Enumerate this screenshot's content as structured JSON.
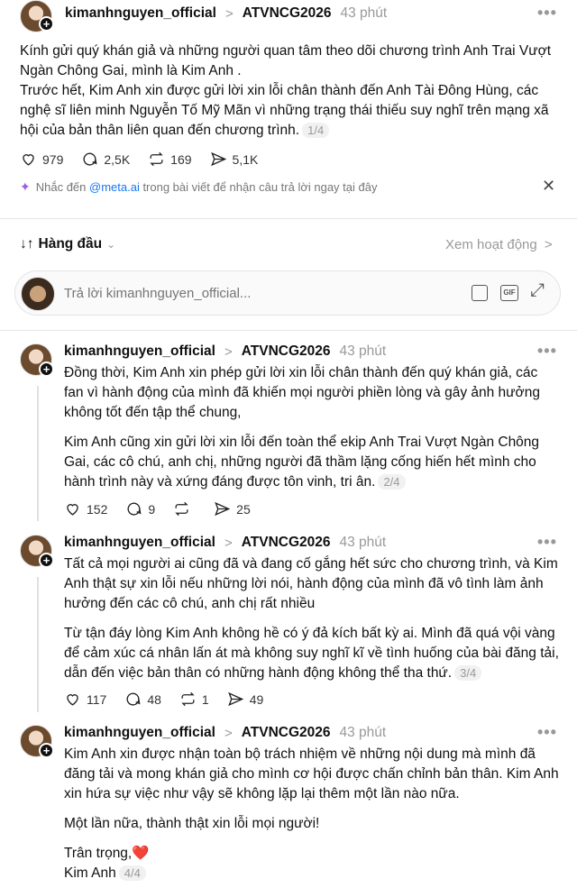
{
  "post": {
    "username": "kimanhnguyen_official",
    "tag": "ATVNCG2026",
    "time": "43 phút",
    "paragraphs": [
      "Kính gửi quý khán giả và những người quan tâm theo dõi chương trình Anh Trai Vượt Ngàn Chông Gai, mình là Kim Anh .",
      "Trước hết, Kim Anh xin được gửi lời xin lỗi chân thành đến Anh Tài Đông Hùng, các nghệ sĩ liên minh Nguyễn Tố Mỹ Mãn vì những trạng thái thiếu suy nghĩ trên mạng xã hội của bản thân liên quan đến chương trình."
    ],
    "page": "1/4",
    "likes": "979",
    "replies": "2,5K",
    "reposts": "169",
    "shares": "5,1K"
  },
  "meta_hint": {
    "prefix": "Nhắc đến ",
    "handle": "@meta.ai",
    "suffix": " trong bài viết để nhận câu trả lời ngay tại đây"
  },
  "sort": {
    "label": "Hàng đầu",
    "activity": "Xem hoạt động"
  },
  "reply_box": {
    "placeholder": "Trả lời kimanhnguyen_official..."
  },
  "replies": [
    {
      "username": "kimanhnguyen_official",
      "tag": "ATVNCG2026",
      "time": "43 phút",
      "paragraphs": [
        "Đồng thời, Kim Anh xin phép gửi lời xin lỗi chân thành đến quý khán giả, các fan vì hành động của mình đã khiến mọi người phiền lòng và gây ảnh hưởng không tốt đến tập thể chung,",
        "Kim Anh cũng xin gửi lời xin lỗi đến toàn thể ekip Anh Trai Vượt Ngàn Chông Gai, các cô chú, anh chị, những người đã thầm lặng cống hiến hết mình cho hành trình này và xứng đáng được tôn vinh, tri ân."
      ],
      "page": "2/4",
      "likes": "152",
      "replies": "9",
      "reposts": "",
      "shares": "25"
    },
    {
      "username": "kimanhnguyen_official",
      "tag": "ATVNCG2026",
      "time": "43 phút",
      "paragraphs": [
        "Tất cả mọi người ai cũng đã và đang cố gắng hết sức cho chương trình, và Kim Anh thật sự xin lỗi nếu những lời nói, hành động của mình đã vô tình làm ảnh hưởng đến các cô chú, anh chị rất nhiều",
        "Từ tận đáy lòng Kim Anh không hề có ý đả kích bất kỳ ai. Mình đã quá vội vàng để cảm xúc cá nhân lấn át mà không suy nghĩ kĩ về tình huống của bài đăng tải, dẫn đến việc bản thân có những hành động không thể tha thứ."
      ],
      "page": "3/4",
      "likes": "117",
      "replies": "48",
      "reposts": "1",
      "shares": "49"
    },
    {
      "username": "kimanhnguyen_official",
      "tag": "ATVNCG2026",
      "time": "43 phút",
      "paragraphs": [
        "Kim Anh xin được nhận toàn bộ trách nhiệm về những nội dung mà mình đã đăng tải và mong khán giả cho mình cơ hội được chấn chỉnh bản thân. Kim Anh xin hứa sự việc như vậy sẽ không lặp lại thêm một lần nào nữa.",
        "Một lần nữa, thành thật xin lỗi mọi người!",
        "Trân trọng,❤️",
        "Kim Anh"
      ],
      "page": "4/4"
    }
  ],
  "colors": {
    "text": "#101010",
    "muted": "#999999",
    "link": "#1877f2",
    "heart": "#d7263d"
  }
}
